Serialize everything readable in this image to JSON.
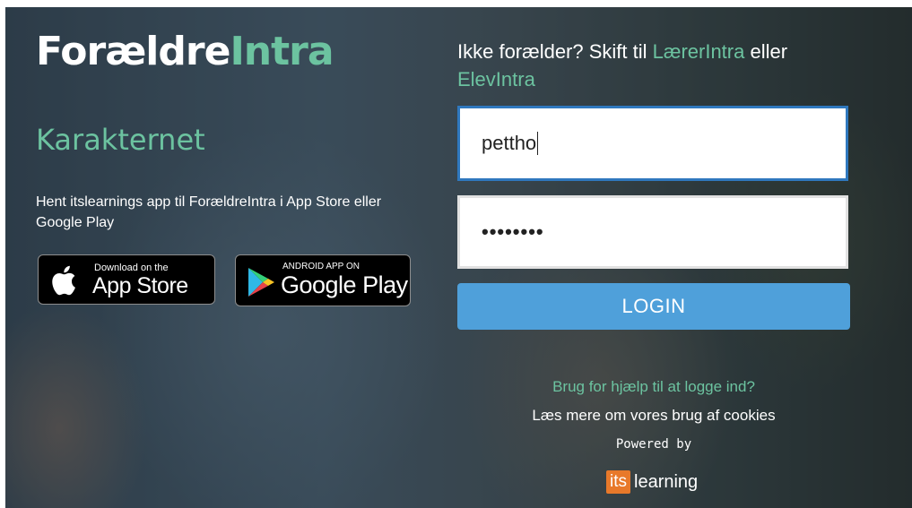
{
  "brand": {
    "name_part1": "Forældre",
    "name_part2": "Intra"
  },
  "school_name": "Karakternet",
  "app_promo": {
    "text": "Hent itslearnings app til ForældreIntra i App Store eller Google Play",
    "app_store": {
      "small": "Download on the",
      "big": "App Store"
    },
    "google_play": {
      "small": "ANDROID APP ON",
      "big": "Google Play"
    }
  },
  "switch_role": {
    "prefix": "Ikke forælder? Skift til ",
    "link1": "LærerIntra",
    "middle": " eller",
    "link2": "ElevIntra"
  },
  "login_form": {
    "username_value": "pettho",
    "password_value": "••••••••",
    "login_label": "LOGIN"
  },
  "footer": {
    "help_link": "Brug for hjælp til at logge ind?",
    "cookies_link": "Læs mere om vores brug af cookies",
    "powered_by": "Powered by",
    "its": "its",
    "learning": "learning"
  },
  "colors": {
    "accent_green": "#6cc3a0",
    "button_blue": "#4fa0da",
    "focus_border": "#2f78be",
    "its_orange": "#e8792a"
  }
}
